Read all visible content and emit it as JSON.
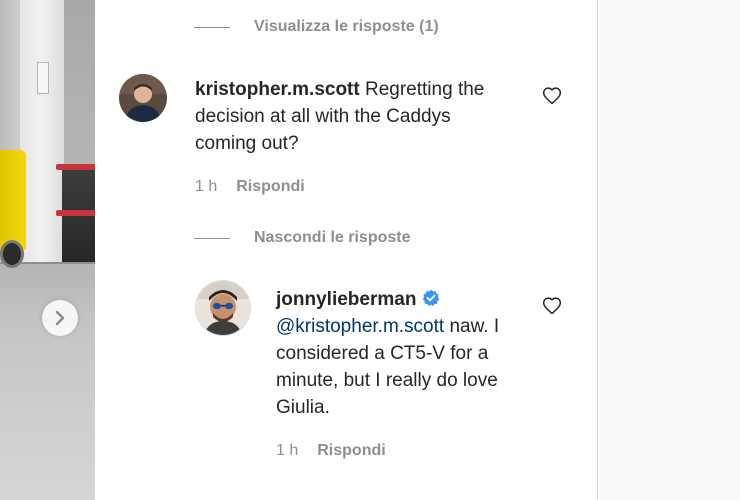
{
  "thread": {
    "view_replies_label": "Visualizza le risposte (1)",
    "hide_replies_label": "Nascondi le risposte"
  },
  "comments": [
    {
      "username": "kristopher.m.scott",
      "text": "Regretting the decision at all with the Caddys coming out?",
      "time": "1 h",
      "reply_label": "Rispondi",
      "like_icon": "heart-outline-icon"
    }
  ],
  "replies": [
    {
      "username": "jonnylieberman",
      "verified": true,
      "mention": "@kristopher.m.scott",
      "text": " naw. I considered a CT5-V for a minute, but I really do love Giulia.",
      "time": "1 h",
      "reply_label": "Rispondi",
      "like_icon": "heart-outline-icon"
    }
  ],
  "colors": {
    "text": "#262626",
    "muted": "#8e8e8e",
    "mention": "#00376b",
    "verified": "#3897f0"
  },
  "icons": {
    "carousel_next": "chevron-right-icon",
    "verified": "verified-badge-icon"
  }
}
